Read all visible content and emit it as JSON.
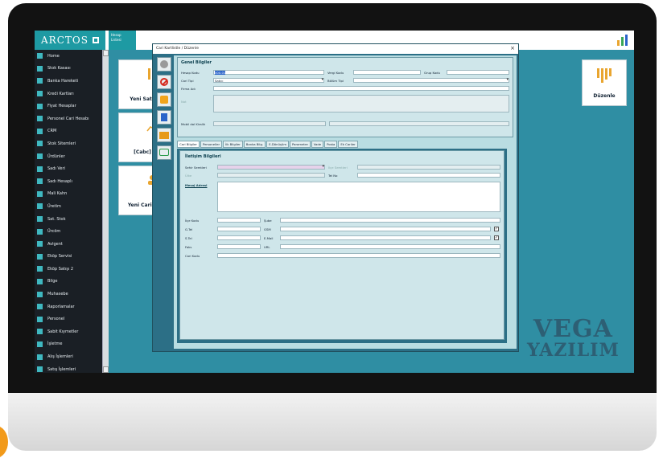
{
  "app": {
    "brand": "ARCTOS",
    "top_tab_line1": "Hesap",
    "top_tab_line2": "Listesi"
  },
  "sidebar": {
    "items": [
      {
        "label": "Home",
        "icon": "home-icon"
      },
      {
        "label": "Stok Kasası",
        "icon": "box-icon"
      },
      {
        "label": "Banka Hareketi",
        "icon": "bank-icon"
      },
      {
        "label": "Kredi Kartları",
        "icon": "card-icon"
      },
      {
        "label": "Fiyat Hesaplar",
        "icon": "calc-icon"
      },
      {
        "label": "Personel Cari Hesabı",
        "icon": "person-icon"
      },
      {
        "label": "CRM",
        "icon": "crm-icon"
      },
      {
        "label": "Stok Sitemleri",
        "icon": "stock-icon"
      },
      {
        "label": "Ürdünler",
        "icon": "product-icon"
      },
      {
        "label": "Sadı Veri",
        "icon": "data-icon"
      },
      {
        "label": "Sadı Hesaplı",
        "icon": "check-icon"
      },
      {
        "label": "Mali Kahn",
        "icon": "finance-icon"
      },
      {
        "label": "Üretim",
        "icon": "production-icon"
      },
      {
        "label": "Sat. Stok",
        "icon": "share-icon"
      },
      {
        "label": "Ürcöm",
        "icon": "doc-icon"
      },
      {
        "label": "Avlgent",
        "icon": "agent-icon"
      },
      {
        "label": "Eköp Servisi",
        "icon": "service-icon"
      },
      {
        "label": "Eköp Satışı 2",
        "icon": "service2-icon"
      },
      {
        "label": "Bilge",
        "icon": "bulb-icon"
      },
      {
        "label": "Muhasebe",
        "icon": "ledger-icon"
      },
      {
        "label": "Raporlamalar",
        "icon": "report-icon"
      },
      {
        "label": "Personel",
        "icon": "staff-icon"
      },
      {
        "label": "Sabit Kıymetler",
        "icon": "asset-icon"
      },
      {
        "label": "İşletme",
        "icon": "business-icon"
      },
      {
        "label": "Alış İşlemleri",
        "icon": "purchase-icon"
      },
      {
        "label": "Satış İşlemleri",
        "icon": "sales-icon"
      }
    ]
  },
  "dashboard": {
    "card1_label": "Yeni Saty",
    "card2_label": "[Cabc]",
    "card3_label": "Yeni Cari Ç",
    "card_right_label": "Düzenle"
  },
  "dialog": {
    "title": "Cari Kartlistle / Düzenle",
    "close": "×",
    "genel_title": "Genel Bilgiler",
    "f_hesap_kodu": "Hesap Kodu",
    "v_hesap_kodu": "000.01",
    "f_vergi_kodu": "Vergi Kodu",
    "f_grup_kodu": "Grup Kodu",
    "f_cari_tipi": "Cari Tipi",
    "v_cari_tipi": "Satıcı",
    "f_bolum_tipi": "Bölüm Tipi",
    "f_firma_adi": "Firma Adı",
    "f_not": "Not",
    "f_mobil": "Mobil dal Kiralik",
    "tabs": [
      "Cari Bilgiler",
      "Personeller",
      "İlk Bilgiler",
      "Banka Bilg.",
      "E-Dönüşüm",
      "Parametre",
      "Vade",
      "Posta",
      "Ek Cariler"
    ],
    "iletisim_title": "İletişim Bilgileri",
    "f_sehir": "Sehir Semtleri",
    "f_ilce": "İlçe Semtleri",
    "f_ulke": "Ülke",
    "f_tel_no": "Tel No",
    "f_adres": "Mesaj Adresi",
    "f_ilce_kodu": "İlçe Kodu",
    "f_sube": "Şube",
    "f_tel": "G.Tel",
    "f_gsm": "GSM",
    "f_stel": "S.Tel",
    "f_email": "E-Mail",
    "f_faks": "Faks",
    "f_url": "URL",
    "f_cari_kodu": "Cari Kodu"
  },
  "watermark": {
    "line1": "VEGA",
    "line2": "YAZILIM"
  }
}
